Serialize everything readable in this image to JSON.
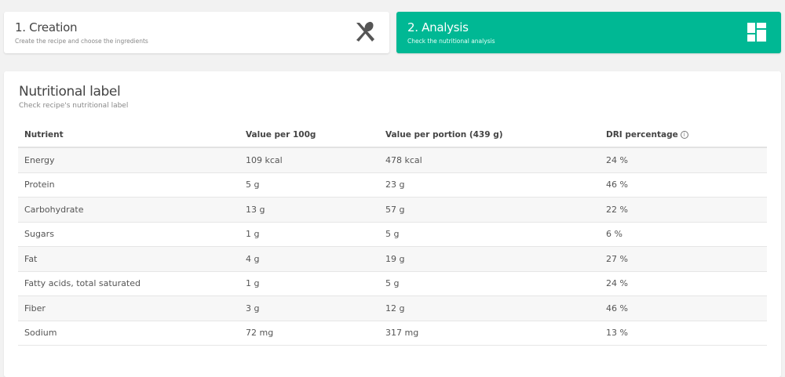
{
  "steps": [
    {
      "title": "1. Creation",
      "subtitle": "Create the recipe and choose the ingredients",
      "icon": "utensils-icon"
    },
    {
      "title": "2. Analysis",
      "subtitle": "Check the nutritional analysis",
      "icon": "dashboard-icon"
    }
  ],
  "colors": {
    "accent": "#00b894"
  },
  "label": {
    "title": "Nutritional label",
    "subtitle": "Check recipe's nutritional label",
    "columns": [
      "Nutrient",
      "Value per 100g",
      "Value per portion (439 g)",
      "DRI percentage"
    ],
    "info_glyph": "i",
    "rows": [
      [
        "Energy",
        "109 kcal",
        "478 kcal",
        "24 %"
      ],
      [
        "Protein",
        "5 g",
        "23 g",
        "46 %"
      ],
      [
        "Carbohydrate",
        "13 g",
        "57 g",
        "22 %"
      ],
      [
        "Sugars",
        "1 g",
        "5 g",
        "6 %"
      ],
      [
        "Fat",
        "4 g",
        "19 g",
        "27 %"
      ],
      [
        "Fatty acids, total saturated",
        "1 g",
        "5 g",
        "24 %"
      ],
      [
        "Fiber",
        "3 g",
        "12 g",
        "46 %"
      ],
      [
        "Sodium",
        "72 mg",
        "317 mg",
        "13 %"
      ]
    ]
  }
}
